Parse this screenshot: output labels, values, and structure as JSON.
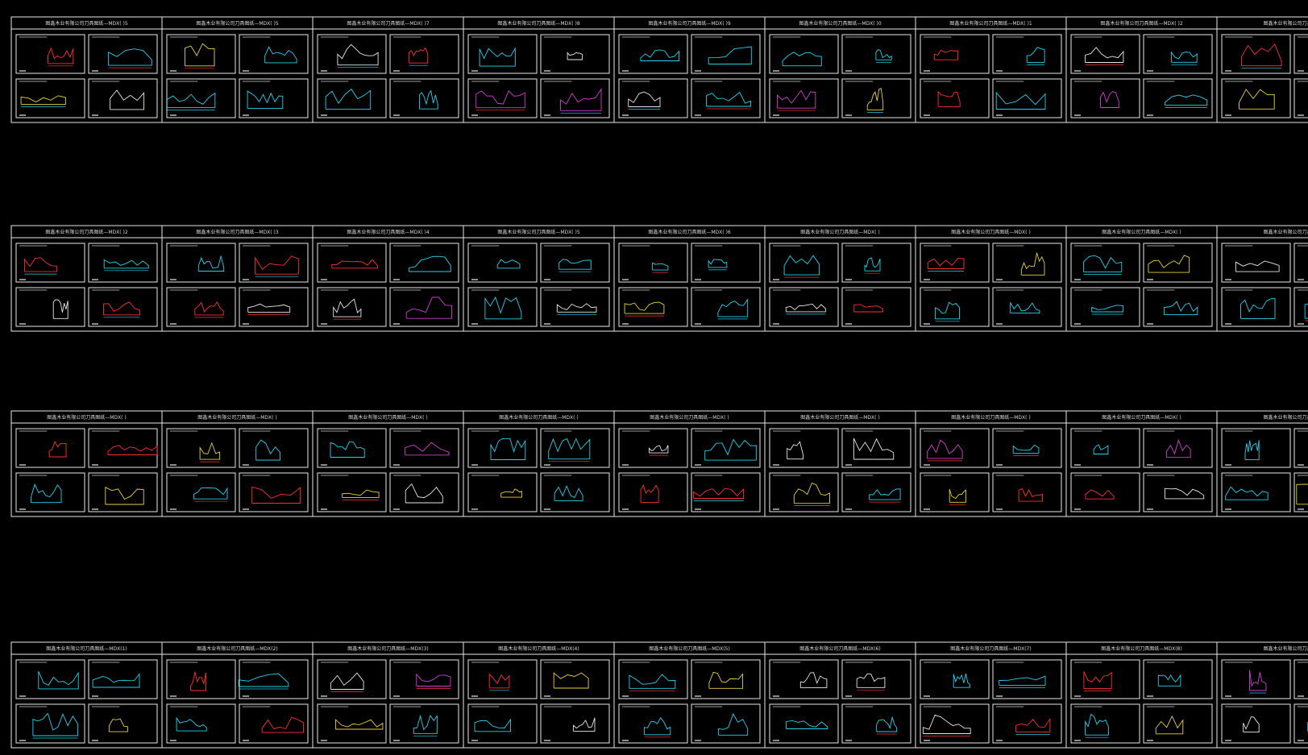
{
  "app": {
    "title": ""
  },
  "colors": {
    "background": "#000000",
    "frame": "#e8e8e8",
    "cyan": "#22d3ee",
    "white": "#e8e8e8",
    "yellow": "#e8d23a",
    "red": "#ff3030",
    "magenta": "#d040d0",
    "blue": "#4466ff",
    "green": "#6aaa4a",
    "orange": "#e08a30"
  },
  "rows": [
    {
      "sheets": [
        {
          "title": "图鑫木业有限公司刀具图纸—MDX(   )5"
        },
        {
          "title": "图鑫木业有限公司刀具图纸—MDX(   )5"
        },
        {
          "title": "图鑫木业有限公司刀具图纸—MDX(   )7"
        },
        {
          "title": "图鑫木业有限公司刀具图纸—MDX(   )8"
        },
        {
          "title": "图鑫木业有限公司刀具图纸—MDX(   )9"
        },
        {
          "title": "图鑫木业有限公司刀具图纸—MDX(   )0"
        },
        {
          "title": "图鑫木业有限公司刀具图纸—MDX(   )1"
        },
        {
          "title": "图鑫木业有限公司刀具图纸—MDX(   )2"
        },
        {
          "title": "图鑫木业有限公司刀具图纸"
        }
      ]
    },
    {
      "sheets": [
        {
          "title": "图鑫木业有限公司刀具图纸—MDX(   )2"
        },
        {
          "title": "图鑫木业有限公司刀具图纸—MDX(   )3"
        },
        {
          "title": "图鑫木业有限公司刀具图纸—MDX(   )4"
        },
        {
          "title": "图鑫木业有限公司刀具图纸—MDX(   )5"
        },
        {
          "title": "图鑫木业有限公司刀具图纸—MDX(   )6"
        },
        {
          "title": "图鑫木业有限公司刀具图纸—MDX(   )"
        },
        {
          "title": "图鑫木业有限公司刀具图纸—MDX(   )"
        },
        {
          "title": "图鑫木业有限公司刀具图纸—MDX(   )"
        },
        {
          "title": "图鑫木业有限公司刀具图纸"
        }
      ]
    },
    {
      "sheets": [
        {
          "title": "图鑫木业有限公司刀具图纸—MDX(   )"
        },
        {
          "title": "图鑫木业有限公司刀具图纸—MDX(   )"
        },
        {
          "title": "图鑫木业有限公司刀具图纸—MDX(   )"
        },
        {
          "title": "图鑫木业有限公司刀具图纸—MDX(   )"
        },
        {
          "title": "图鑫木业有限公司刀具图纸—MDX(   )"
        },
        {
          "title": "图鑫木业有限公司刀具图纸—MDX(   )"
        },
        {
          "title": "图鑫木业有限公司刀具图纸—MDX(   )"
        },
        {
          "title": "图鑫木业有限公司刀具图纸—MDX(   )"
        },
        {
          "title": "图鑫木业有限公司刀具图纸"
        }
      ]
    },
    {
      "sheets": [
        {
          "title": "图鑫木业有限公司刀具图纸—MDX(1)"
        },
        {
          "title": "图鑫木业有限公司刀具图纸—MDX(2)"
        },
        {
          "title": "图鑫木业有限公司刀具图纸—MDX(3)"
        },
        {
          "title": "图鑫木业有限公司刀具图纸—MDX(4)"
        },
        {
          "title": "图鑫木业有限公司刀具图纸—MDX(5)"
        },
        {
          "title": "图鑫木业有限公司刀具图纸—MDX(6)"
        },
        {
          "title": "图鑫木业有限公司刀具图纸—MDX(7)"
        },
        {
          "title": "图鑫木业有限公司刀具图纸—MDX(8)"
        },
        {
          "title": "图鑫木业有限公司刀具图纸"
        }
      ]
    }
  ]
}
